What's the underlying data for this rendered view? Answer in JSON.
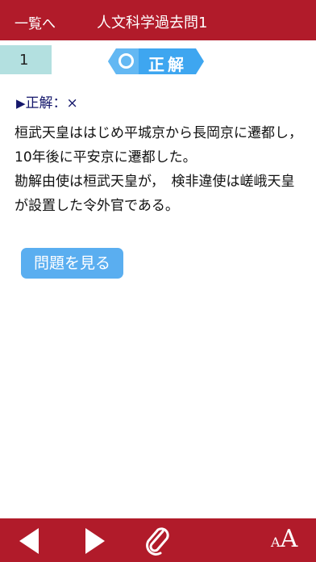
{
  "header": {
    "back_label": "一覧へ",
    "title": "人文科学過去問1"
  },
  "question": {
    "number": "1"
  },
  "result": {
    "label": "正解",
    "symbol": "circle-icon",
    "color": "#3ea6f0"
  },
  "answer": {
    "prefix": "▶",
    "label": "正解：",
    "value": "×"
  },
  "explanation": {
    "line1": "桓武天皇ははじめ平城京から長岡京に遷都し，10年後に平安京に遷都した。",
    "line2": "勘解由使は桓武天皇が，　検非違使は嵯峨天皇が設置した令外官である。"
  },
  "actions": {
    "view_question_label": "問題を見る"
  },
  "footer": {
    "font_small": "A",
    "font_large": "A"
  },
  "colors": {
    "header_bg": "#b11b2a",
    "number_box_bg": "#b3e0e0",
    "button_bg": "#5aaef0",
    "answer_text": "#14176b"
  }
}
